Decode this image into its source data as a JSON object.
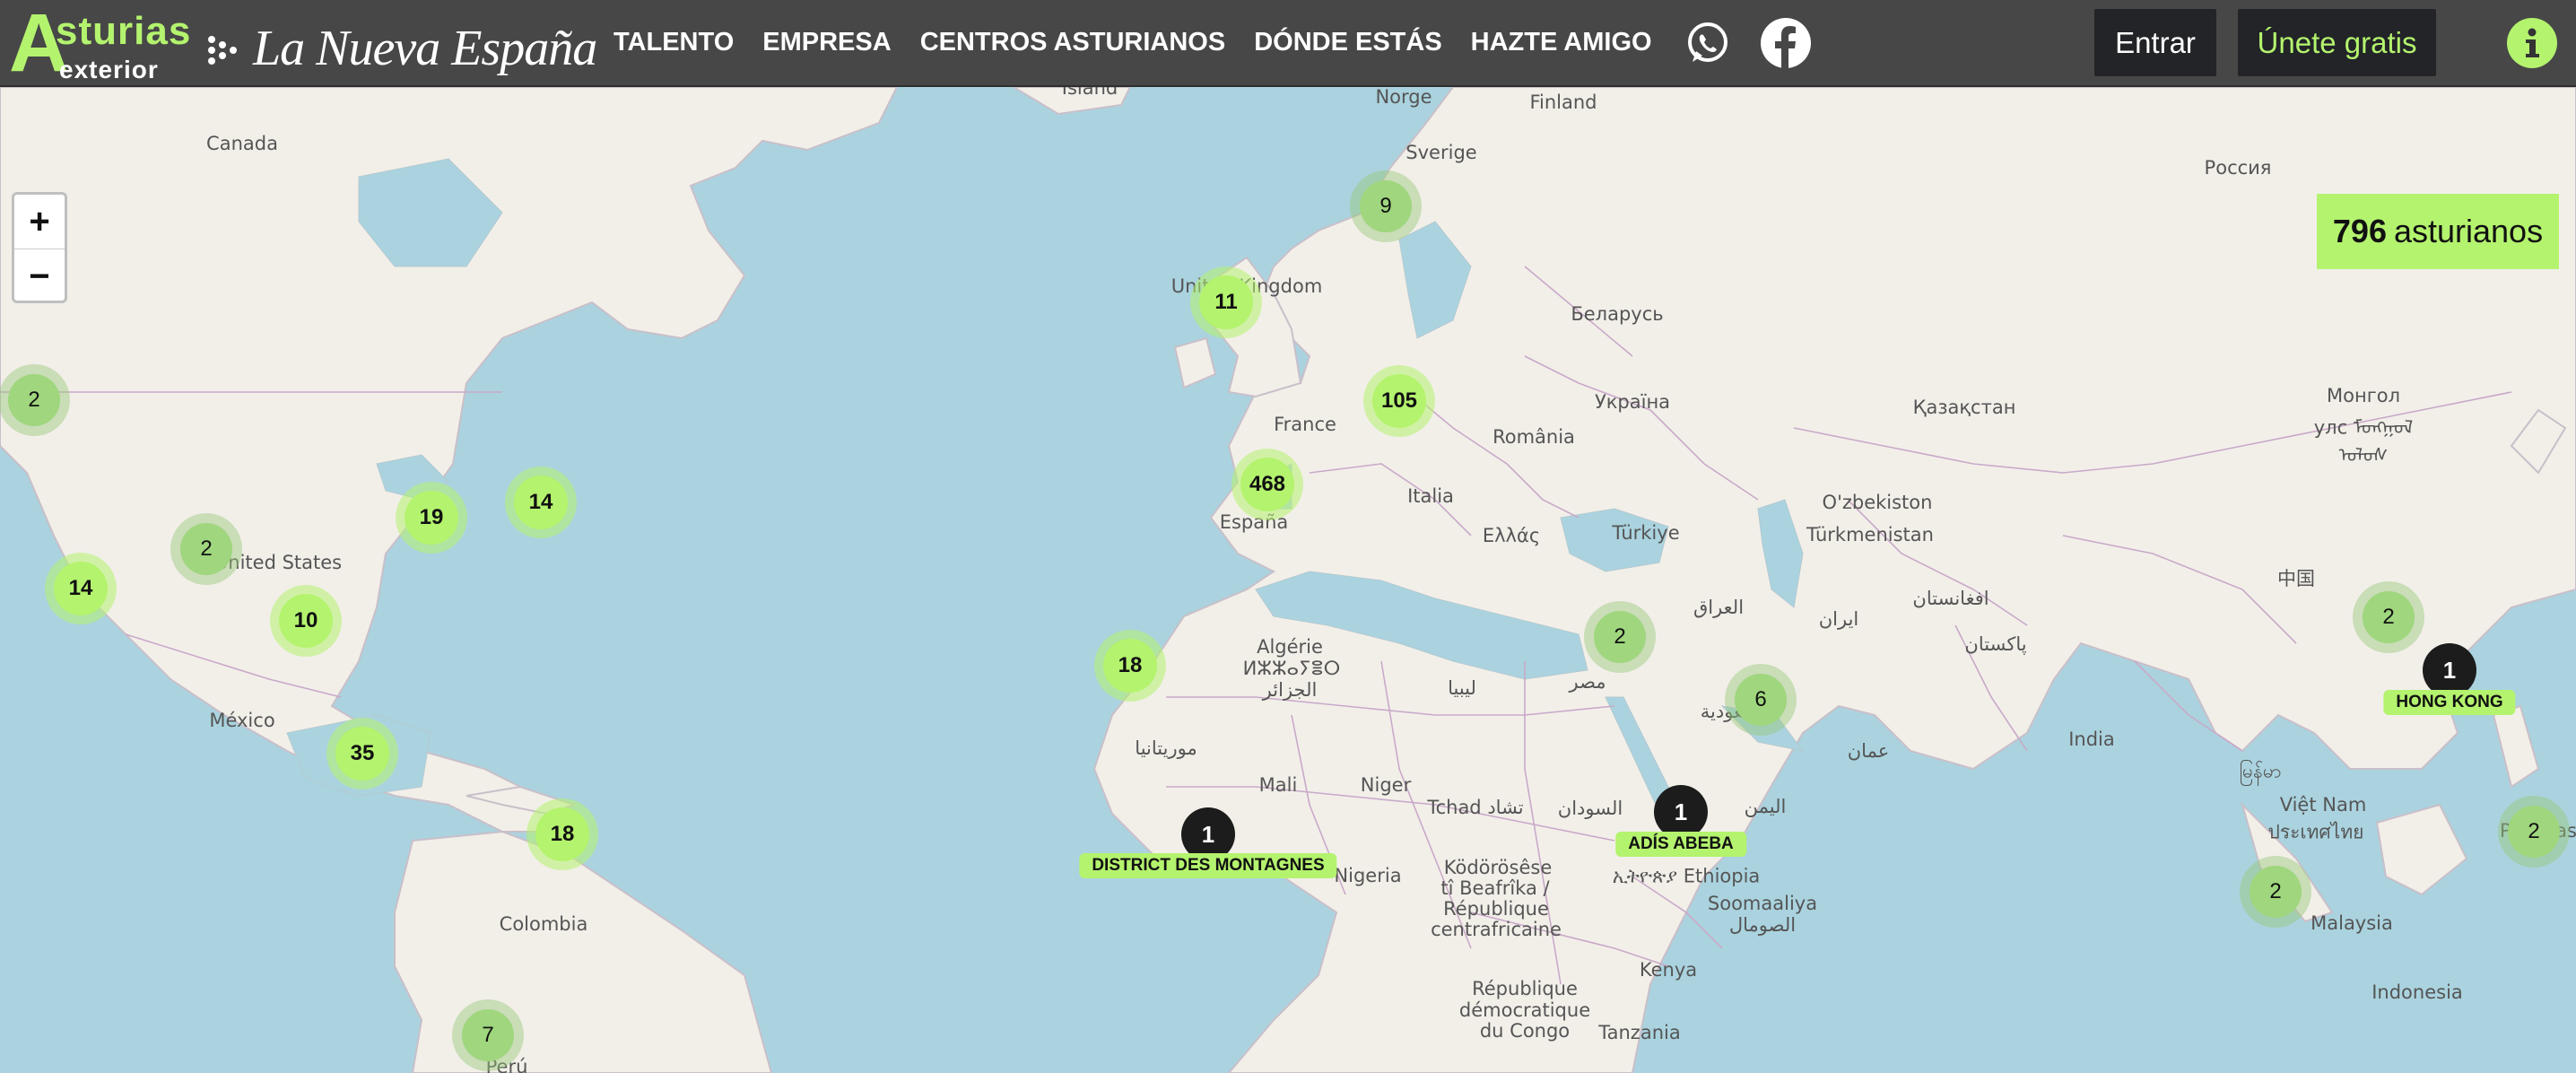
{
  "header": {
    "logo": {
      "letter": "A",
      "rest": "sturias",
      "sub": "exterior",
      "partner": "La Nueva España"
    },
    "nav": [
      "TALENTO",
      "EMPRESA",
      "CENTROS ASTURIANOS",
      "DÓNDE ESTÁS",
      "HAZTE AMIGO"
    ],
    "social_icons": [
      "whatsapp-icon",
      "facebook-icon"
    ],
    "login_label": "Entrar",
    "signup_label": "Únete gratis",
    "info_icon": "info-icon",
    "colors": {
      "accent": "#b4f36e",
      "header_bg": "#474747",
      "button_bg": "#222427"
    }
  },
  "map": {
    "zoom_in": "+",
    "zoom_out": "−",
    "counter": {
      "count": "796",
      "label": "asturianos"
    },
    "place_labels": [
      "Canada",
      "United States",
      "México",
      "Colombia",
      "Perú",
      "Norge",
      "Sverige",
      "Finland",
      "United Kingdom",
      "France",
      "España",
      "Italia",
      "Ελλάς",
      "România",
      "Україна",
      "Беларусь",
      "Россия",
      "Türkiye",
      "Қазақстан",
      "O'zbekiston",
      "Türkmenistan",
      "Монгол",
      "улс ᠮᠣᠩᠭᠣᠯ",
      "ᠤᠯᠤᠰ",
      "中国",
      "افغانستان",
      "العراق",
      "ایران",
      "پاکستان",
      "India",
      "مصر",
      "السعودية",
      "ليبيا",
      "Algérie",
      "ⵍⵣⵣⴰⵢⴻⵔ",
      "الجزائر",
      "موريتانيا",
      "Mali",
      "Niger",
      "Tchad تشاد",
      "السودان",
      "اليمن",
      "عمان",
      "Nigeria",
      "Ködörösêse",
      "tî Beafrîka /",
      "République",
      "centrafricaine",
      "République",
      "démocratique",
      "du Congo",
      "ኢትዮጵያ Ethiopia",
      "Soomaaliya",
      "الصومال",
      "Kenya",
      "Tanzania",
      "Việt Nam",
      "ประเทศไทย",
      "မြန်မာ",
      "Malaysia",
      "Indonesia",
      "Pilipinas",
      "Ísland"
    ],
    "clusters": [
      {
        "count": "2",
        "size": "small"
      },
      {
        "count": "14",
        "size": "big"
      },
      {
        "count": "2",
        "size": "small"
      },
      {
        "count": "19",
        "size": "big"
      },
      {
        "count": "14",
        "size": "big"
      },
      {
        "count": "10",
        "size": "big"
      },
      {
        "count": "35",
        "size": "big"
      },
      {
        "count": "18",
        "size": "big"
      },
      {
        "count": "7",
        "size": "small"
      },
      {
        "count": "11",
        "size": "big"
      },
      {
        "count": "9",
        "size": "small"
      },
      {
        "count": "105",
        "size": "big"
      },
      {
        "count": "468",
        "size": "big"
      },
      {
        "count": "18",
        "size": "big"
      },
      {
        "count": "2",
        "size": "small"
      },
      {
        "count": "6",
        "size": "small"
      },
      {
        "count": "2",
        "size": "small"
      },
      {
        "count": "2",
        "size": "small"
      },
      {
        "count": "2",
        "size": "small"
      }
    ],
    "singles": [
      {
        "count": "1",
        "label": "DISTRICT DES MONTAGNES"
      },
      {
        "count": "1",
        "label": "ADÍS ABEBA"
      },
      {
        "count": "1",
        "label": "HONG KONG"
      }
    ]
  }
}
